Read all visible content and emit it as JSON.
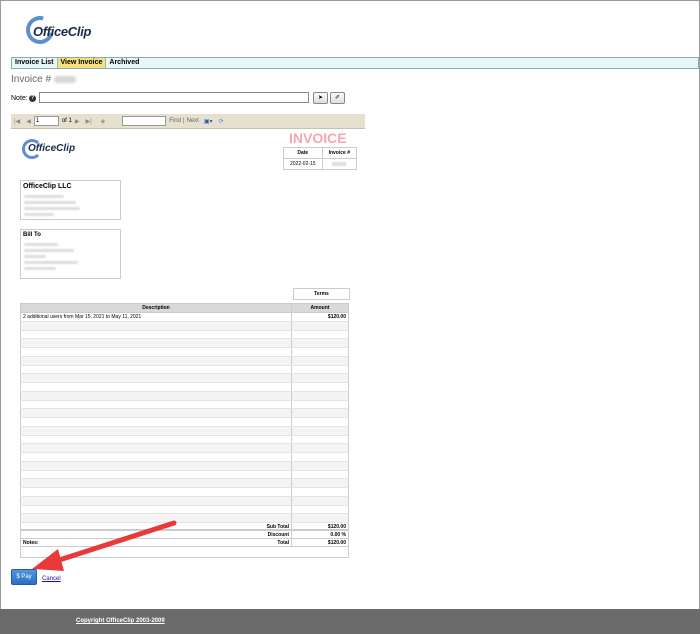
{
  "app": {
    "logo_text": "OfficeClip"
  },
  "tabs": [
    {
      "label": "Invoice List",
      "active": false
    },
    {
      "label": "View Invoice",
      "active": true
    },
    {
      "label": "Archived",
      "active": false
    }
  ],
  "heading": {
    "label": "Invoice #"
  },
  "note": {
    "label": "Note:",
    "help_icon": "?",
    "send_icon": "➤",
    "clear_icon": "✐"
  },
  "report_toolbar": {
    "page_value": "1",
    "of_label": "of 1",
    "find_label": "Find",
    "separator": "|",
    "next_label": "Next"
  },
  "invoice": {
    "title": "INVOICE",
    "logo_text": "OfficeClip",
    "date_header": "Date",
    "number_header": "Invoice #",
    "date_value": "2022-02-15",
    "from_title": "OfficeClip LLC",
    "bill_to_title": "Bill To",
    "terms_label": "Terms",
    "col_description": "Description",
    "col_amount": "Amount",
    "line_items": [
      {
        "description": "2 additional users from Mar 15, 2021 to May 11, 2021",
        "amount": "$120.00"
      }
    ],
    "subtotal_label": "Sub Total",
    "subtotal_value": "$120.00",
    "discount_label": "Discount",
    "discount_value": "0.00 %",
    "total_label": "Total",
    "total_value": "$120.00",
    "notes_label": "Notes:"
  },
  "actions": {
    "pay_label": "$ Pay",
    "cancel_label": "Cancel"
  },
  "footer": {
    "copyright": "Copyright OfficeClip 2003-2009"
  },
  "colors": {
    "accent": "#2a6fc0",
    "invoice_title": "#f4a7b2",
    "active_tab": "#f5e07e",
    "arrow": "#e83a3a"
  }
}
